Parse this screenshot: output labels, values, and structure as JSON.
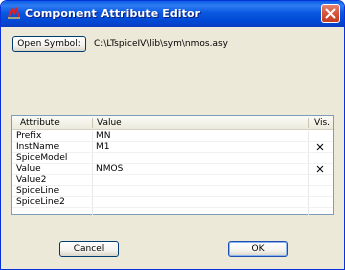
{
  "window": {
    "title": "Component Attribute Editor",
    "icon": "ltspice-app-icon",
    "close_icon": "close-icon"
  },
  "toolbar": {
    "open_symbol_label": "Open Symbol:",
    "symbol_path": "C:\\LTspiceIV\\lib\\sym\\nmos.asy"
  },
  "table": {
    "columns": [
      "Attribute",
      "Value",
      "Vis."
    ],
    "rows": [
      {
        "attribute": "Prefix",
        "value": "MN",
        "visible": false
      },
      {
        "attribute": "InstName",
        "value": "M1",
        "visible": true
      },
      {
        "attribute": "SpiceModel",
        "value": "",
        "visible": false
      },
      {
        "attribute": "Value",
        "value": "NMOS",
        "visible": true
      },
      {
        "attribute": "Value2",
        "value": "",
        "visible": false
      },
      {
        "attribute": "SpiceLine",
        "value": "",
        "visible": false
      },
      {
        "attribute": "SpiceLine2",
        "value": "",
        "visible": false
      }
    ]
  },
  "footer": {
    "cancel_label": "Cancel",
    "ok_label": "OK"
  },
  "colors": {
    "titlebar": "#0a58e0",
    "dialog_bg": "#ece9d8",
    "close_button": "#d6543a",
    "grid_border": "#7f9db9"
  }
}
